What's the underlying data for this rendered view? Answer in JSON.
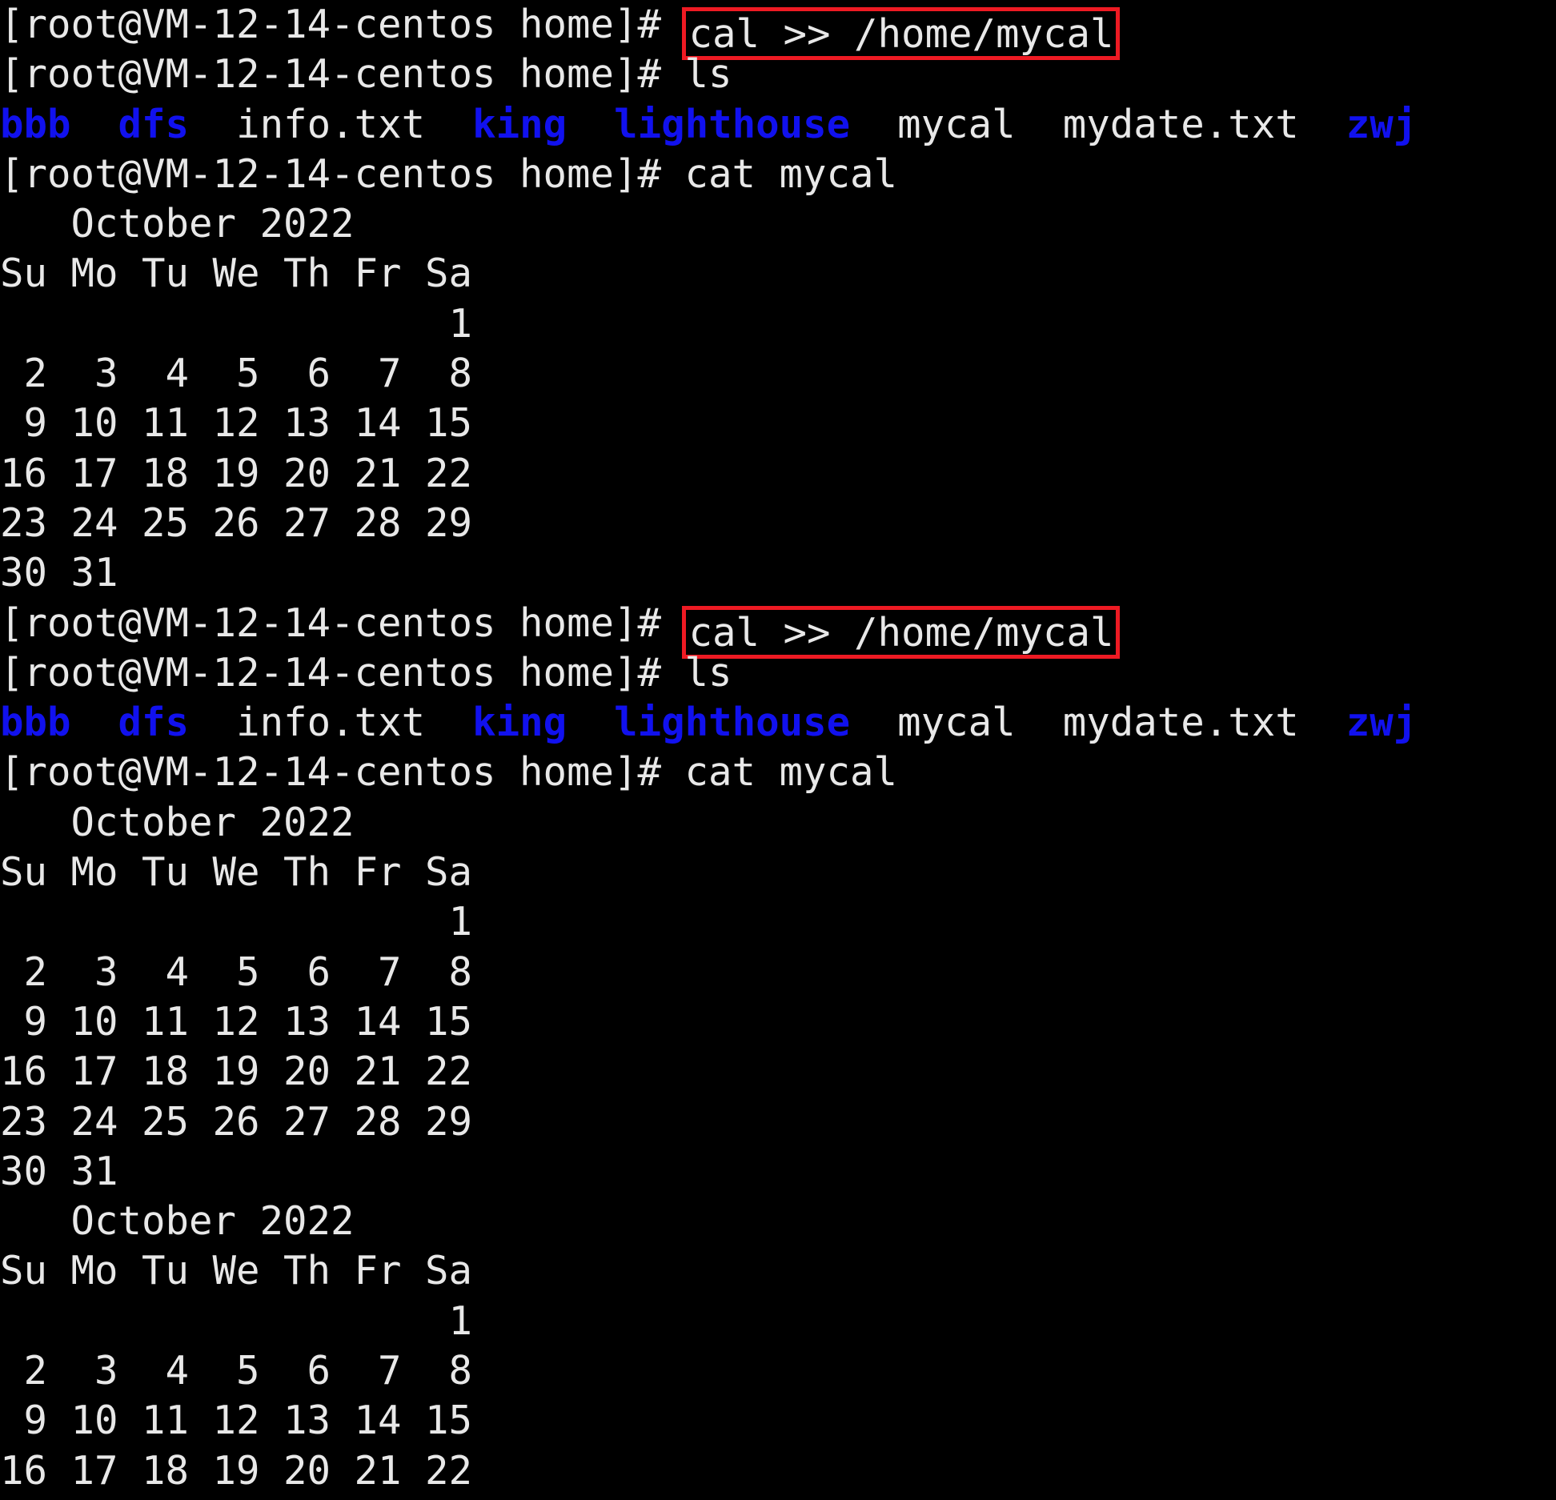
{
  "terminal": {
    "background_color": "#000000",
    "foreground_color": "#e8e8e8",
    "dir_color": "#1111ee",
    "highlight_box_color": "#ee1a23",
    "prompt": "[root@VM-12-14-centos home]# ",
    "commands": {
      "cal_append": "cal >> /home/mycal",
      "ls": "ls",
      "cat_mycal": "cat mycal"
    },
    "ls_output": {
      "entries": [
        {
          "name": "bbb",
          "type": "dir"
        },
        {
          "name": "dfs",
          "type": "dir"
        },
        {
          "name": "info.txt",
          "type": "file"
        },
        {
          "name": "king",
          "type": "dir"
        },
        {
          "name": "lighthouse",
          "type": "dir"
        },
        {
          "name": "mycal",
          "type": "file"
        },
        {
          "name": "mydate.txt",
          "type": "file"
        },
        {
          "name": "zwj",
          "type": "dir"
        }
      ],
      "raw": "bbb  dfs  info.txt  king  lighthouse  mycal  mydate.txt  zwj"
    },
    "calendar": {
      "title": "   October 2022",
      "weekday_header": "Su Mo Tu We Th Fr Sa",
      "weeks": [
        "                   1",
        " 2  3  4  5  6  7  8",
        " 9 10 11 12 13 14 15",
        "16 17 18 19 20 21 22",
        "23 24 25 26 27 28 29",
        "30 31"
      ],
      "month": "October",
      "year": "2022"
    },
    "lines": [
      {
        "id": "l1",
        "type": "prompt-boxed",
        "command_key": "cal_append"
      },
      {
        "id": "l2",
        "type": "prompt",
        "command_key": "ls"
      },
      {
        "id": "l3",
        "type": "ls-output"
      },
      {
        "id": "l4",
        "type": "prompt",
        "command_key": "cat_mycal"
      },
      {
        "id": "l5",
        "type": "cal-title"
      },
      {
        "id": "l6",
        "type": "cal-header"
      },
      {
        "id": "l7",
        "type": "cal-week",
        "week": 0
      },
      {
        "id": "l8",
        "type": "cal-week",
        "week": 1
      },
      {
        "id": "l9",
        "type": "cal-week",
        "week": 2
      },
      {
        "id": "l10",
        "type": "cal-week",
        "week": 3
      },
      {
        "id": "l11",
        "type": "cal-week",
        "week": 4
      },
      {
        "id": "l12",
        "type": "cal-week",
        "week": 5
      },
      {
        "id": "l13",
        "type": "prompt-boxed",
        "command_key": "cal_append"
      },
      {
        "id": "l14",
        "type": "prompt",
        "command_key": "ls"
      },
      {
        "id": "l15",
        "type": "ls-output"
      },
      {
        "id": "l16",
        "type": "prompt",
        "command_key": "cat_mycal"
      },
      {
        "id": "l17",
        "type": "cal-title"
      },
      {
        "id": "l18",
        "type": "cal-header"
      },
      {
        "id": "l19",
        "type": "cal-week",
        "week": 0
      },
      {
        "id": "l20",
        "type": "cal-week",
        "week": 1
      },
      {
        "id": "l21",
        "type": "cal-week",
        "week": 2
      },
      {
        "id": "l22",
        "type": "cal-week",
        "week": 3
      },
      {
        "id": "l23",
        "type": "cal-week",
        "week": 4
      },
      {
        "id": "l24",
        "type": "cal-week",
        "week": 5
      },
      {
        "id": "l25",
        "type": "cal-title"
      },
      {
        "id": "l26",
        "type": "cal-header"
      },
      {
        "id": "l27",
        "type": "cal-week",
        "week": 0
      },
      {
        "id": "l28",
        "type": "cal-week",
        "week": 1
      },
      {
        "id": "l29",
        "type": "cal-week",
        "week": 2
      },
      {
        "id": "l30",
        "type": "cal-week",
        "week": 3
      }
    ]
  }
}
